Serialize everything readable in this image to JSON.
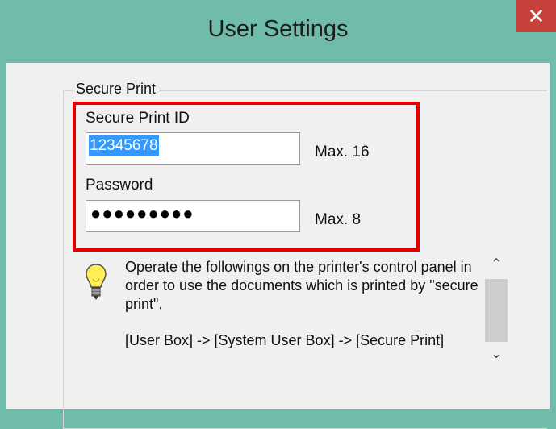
{
  "window": {
    "title": "User Settings",
    "close_glyph": "✕"
  },
  "secure_print": {
    "group_label": "Secure Print",
    "id_label": "Secure Print ID",
    "id_value": "12345678",
    "id_max": "Max. 16",
    "password_label": "Password",
    "password_mask": "●●●●●●●●●",
    "password_max": "Max. 8"
  },
  "info": {
    "icon": "lightbulb-icon",
    "text": "Operate the followings on the printer's control panel in order to use the documents which is printed by \"secure print\".",
    "path": "[User Box] -> [System User Box] -> [Secure Print]"
  },
  "scrollbar": {
    "up_glyph": "⌃",
    "down_glyph": "⌄"
  },
  "colors": {
    "titlebar": "#6fbcaa",
    "close_button": "#c8403a",
    "highlight_box": "#e50000",
    "selection": "#3399ff"
  }
}
